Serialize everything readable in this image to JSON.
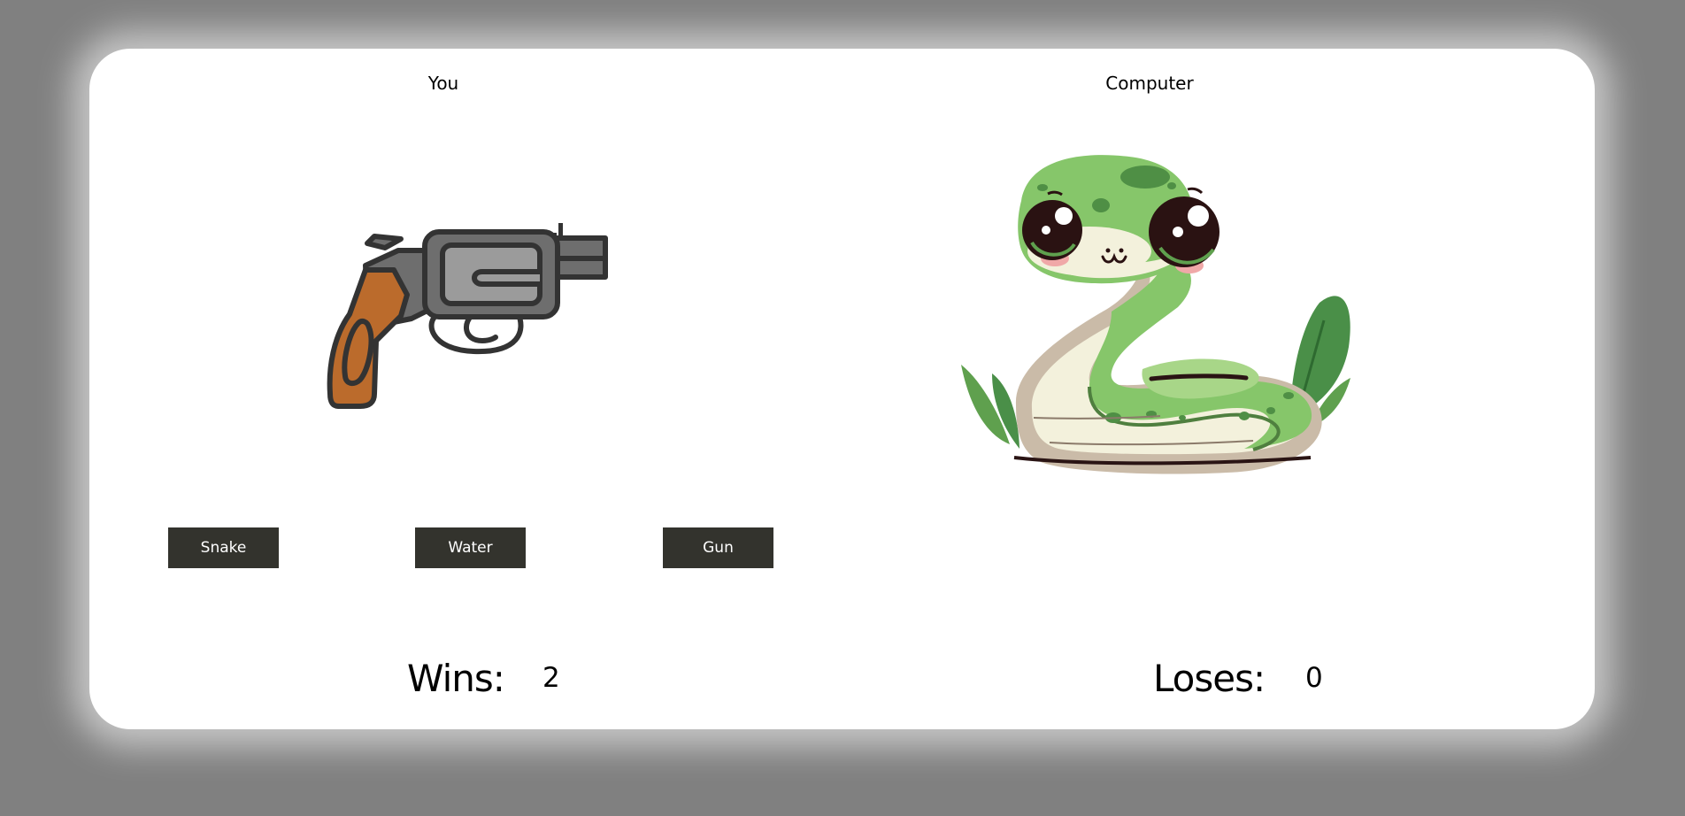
{
  "players": {
    "you_label": "You",
    "computer_label": "Computer"
  },
  "you_choice": {
    "icon": "revolver-icon"
  },
  "computer_choice": {
    "icon": "snake-icon"
  },
  "buttons": {
    "snake": "Snake",
    "water": "Water",
    "gun": "Gun"
  },
  "score": {
    "wins_label": "Wins:",
    "wins_value": "2",
    "loses_label": "Loses:",
    "loses_value": "0"
  },
  "colors": {
    "background": "#808080",
    "card": "#ffffff",
    "button": "#33332d",
    "button_text": "#ffffff"
  }
}
